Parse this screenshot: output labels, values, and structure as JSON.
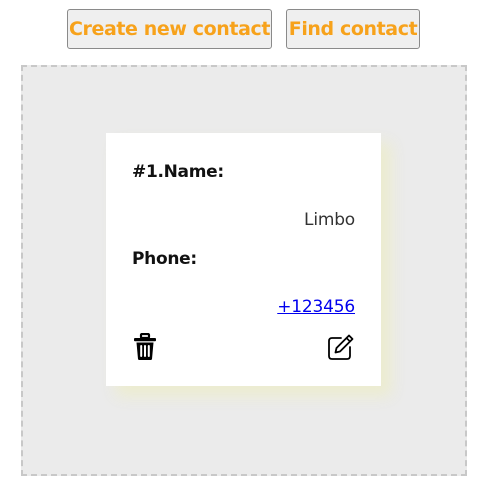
{
  "toolbar": {
    "create_label": "Create new contact",
    "find_label": "Find contact"
  },
  "contact": {
    "name_label": "#1.Name:",
    "name_value": "Limbo",
    "phone_label": "Phone:",
    "phone_value": "+123456"
  },
  "icons": {
    "delete": "trash-icon",
    "edit": "edit-icon"
  },
  "colors": {
    "button_text": "#f7a21b",
    "panel_bg": "#ebebeb",
    "link": "#0000ee"
  }
}
